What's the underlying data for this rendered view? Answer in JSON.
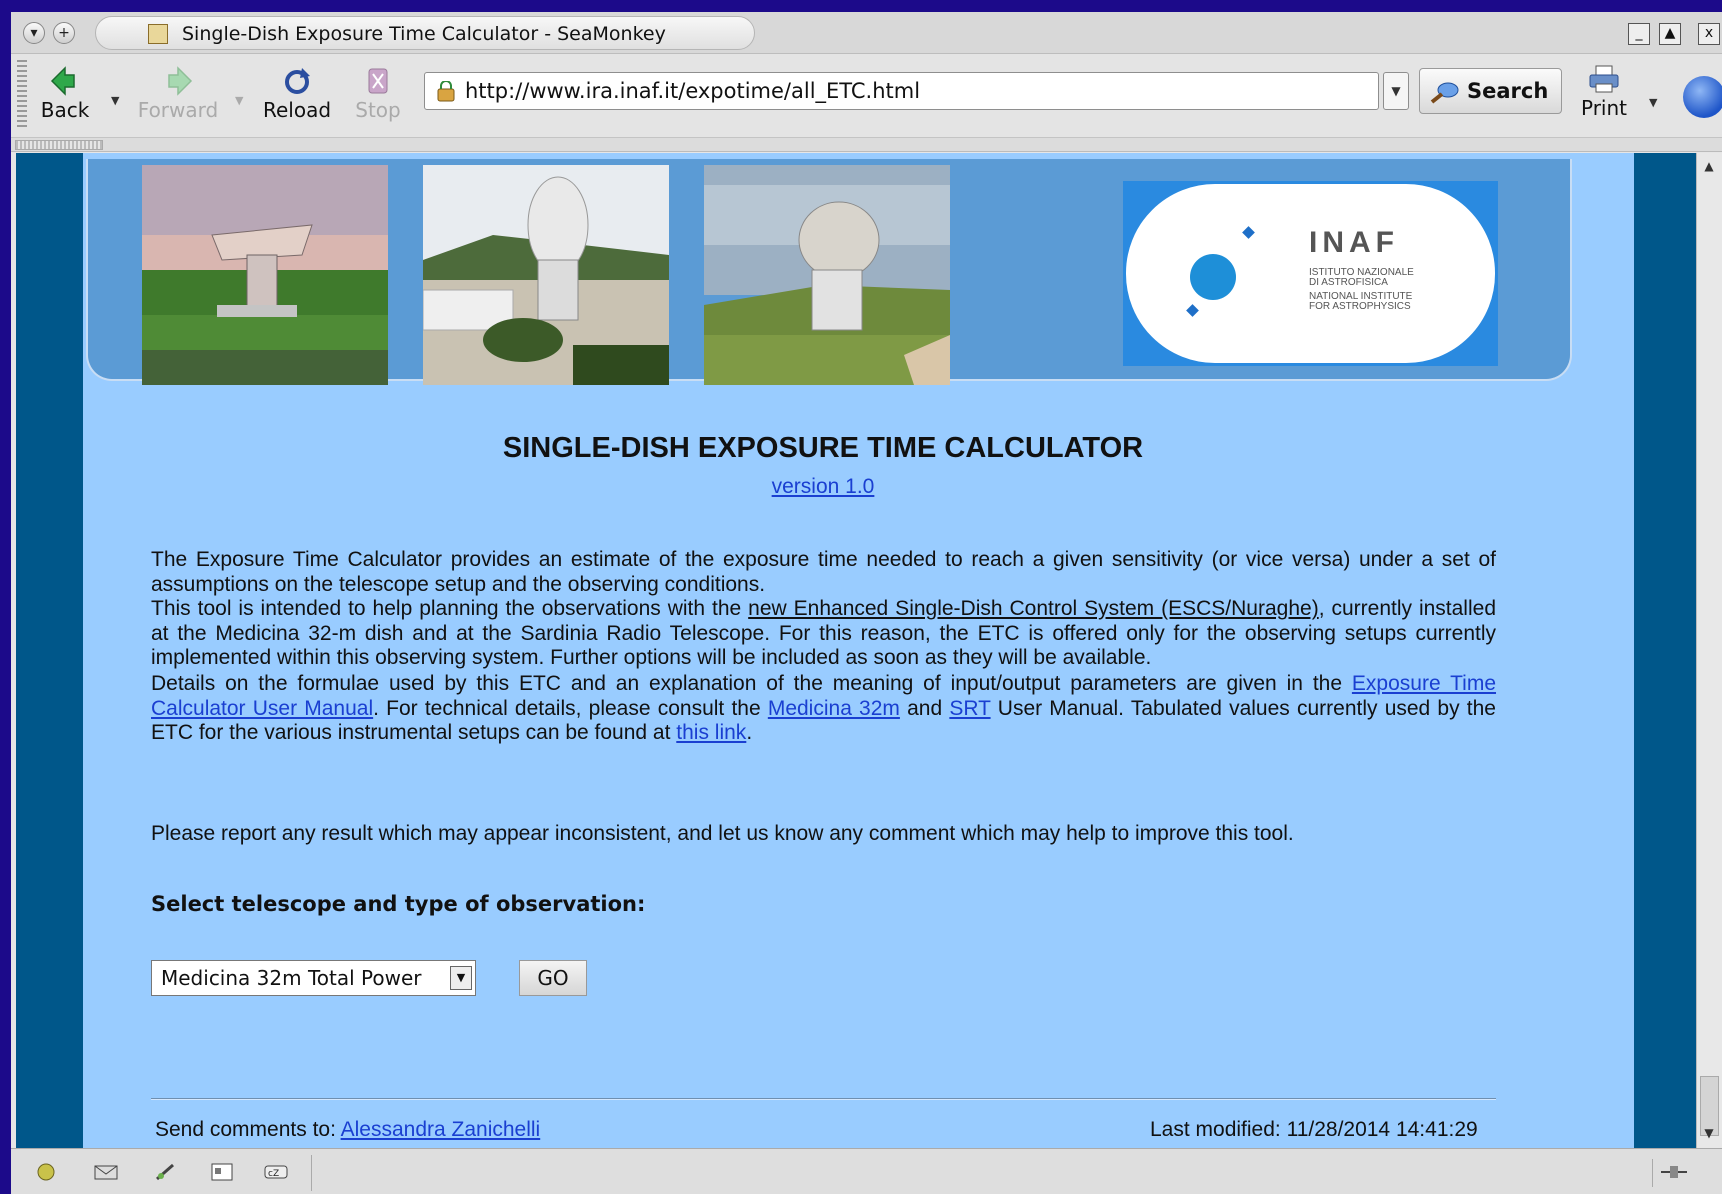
{
  "window": {
    "title": "Single-Dish Exposure Time Calculator - SeaMonkey",
    "controls": {
      "minimize": "_",
      "maximize": "▲",
      "close": "x"
    }
  },
  "toolbar": {
    "back_label": "Back",
    "forward_label": "Forward",
    "reload_label": "Reload",
    "stop_label": "Stop",
    "url": "http://www.ira.inaf.it/expotime/all_ETC.html",
    "search_label": "Search",
    "print_label": "Print"
  },
  "banner": {
    "logo": {
      "name": "INAF",
      "subtitle_it": [
        "ISTITUTO NAZIONALE",
        "DI ASTROFISICA"
      ],
      "subtitle_en": [
        "NATIONAL INSTITUTE",
        "FOR ASTROPHYSICS"
      ]
    }
  },
  "page": {
    "heading": "SINGLE-DISH EXPOSURE TIME CALCULATOR",
    "version_link": "version 1.0",
    "para1": "The Exposure Time Calculator provides an estimate of the exposure time needed to reach a given sensitivity (or vice versa) under a set of assumptions on the telescope setup and the observing conditions.",
    "para2_a": "This tool is intended to help planning the observations with the ",
    "para2_link": "new Enhanced Single-Dish Control System (ESCS/Nuraghe)",
    "para2_b": ", currently installed at the Medicina 32-m dish and at the Sardinia Radio Telescope. For this reason, the ETC is offered only for the observing setups currently implemented within this observing system. Further options will be included as soon as they will be available.",
    "para3_a": "Details on the formulae used by this ETC and an explanation of the meaning of input/output parameters are given in the ",
    "para3_link1": "Exposure Time Calculator User Manual",
    "para3_b": ". For technical details, please consult the ",
    "para3_link2": "Medicina 32m",
    "para3_c": " and ",
    "para3_link3": "SRT",
    "para3_d": " User Manual. Tabulated values currently used by the ETC for the various instrumental setups can be found at ",
    "para3_link4": "this link",
    "para3_e": ".",
    "para4": "Please report any result which may appear inconsistent, and let us know any comment which may help to improve this tool.",
    "select_label": "Select telescope and type of observation:",
    "select_value": "Medicina 32m Total Power",
    "go_label": "GO",
    "footer_prefix": "Send comments to: ",
    "footer_contact": "Alessandra Zanichelli",
    "last_modified": "Last modified: 11/28/2014 14:41:29"
  },
  "colors": {
    "page_bg": "#99ccff",
    "outer_bg": "#00578a",
    "banner_bg": "#5b9bd5",
    "link": "#1a3fd1"
  }
}
